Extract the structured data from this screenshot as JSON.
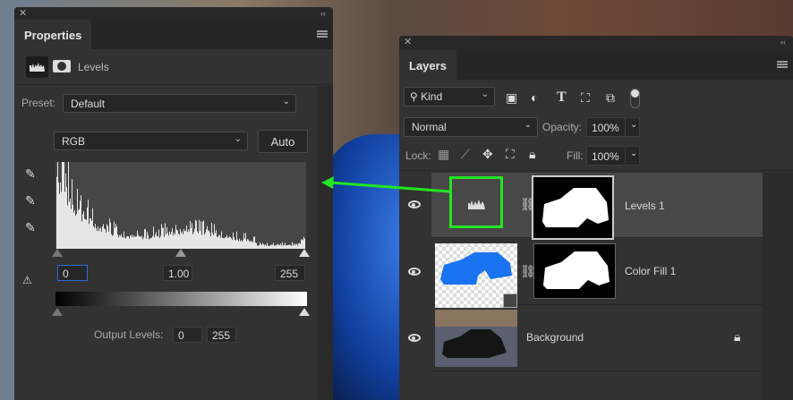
{
  "properties": {
    "title": "Properties",
    "adjustment": "Levels",
    "preset_label": "Preset:",
    "preset_value": "Default",
    "channel": "RGB",
    "auto_label": "Auto",
    "input_black": "0",
    "input_gamma": "1.00",
    "input_white": "255",
    "output_label": "Output Levels:",
    "output_black": "0",
    "output_white": "255"
  },
  "layers": {
    "title": "Layers",
    "filter_kind": "Kind",
    "blend_mode": "Normal",
    "opacity_label": "Opacity:",
    "opacity": "100%",
    "lock_label": "Lock:",
    "fill_label": "Fill:",
    "fill": "100%",
    "items": [
      {
        "name": "Levels 1",
        "selected": true
      },
      {
        "name": "Color Fill 1"
      },
      {
        "name": "Background",
        "locked": true
      }
    ]
  },
  "colors": {
    "highlight": "#22e622",
    "fill_layer": "#1a73f0"
  }
}
